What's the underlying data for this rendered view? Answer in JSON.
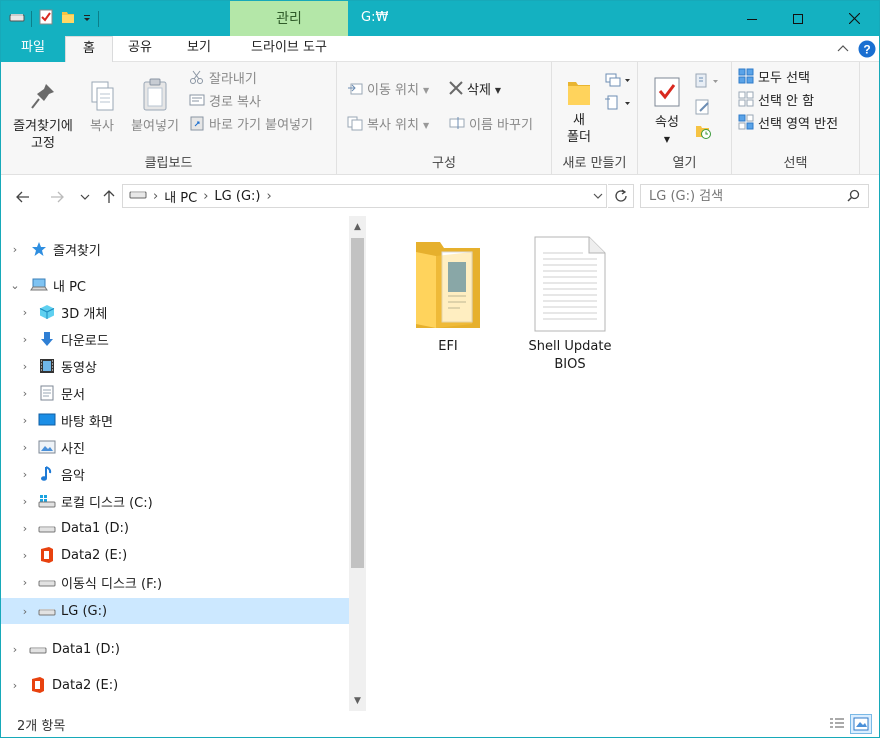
{
  "titlebar": {
    "context_tab": "관리",
    "title": "G:₩",
    "minimize_label": "minimize",
    "maximize_label": "maximize",
    "close_label": "close"
  },
  "tabs": {
    "file": "파일",
    "home": "홈",
    "share": "공유",
    "view": "보기",
    "drive_tools": "드라이브 도구"
  },
  "ribbon": {
    "clipboard": {
      "label": "클립보드",
      "pin_line1": "즐겨찾기에",
      "pin_line2": "고정",
      "copy": "복사",
      "paste": "붙여넣기",
      "cut": "잘라내기",
      "copy_path": "경로 복사",
      "paste_shortcut": "바로 가기 붙여넣기"
    },
    "organize": {
      "label": "구성",
      "move_to": "이동 위치",
      "copy_to": "복사 위치",
      "delete": "삭제",
      "rename": "이름 바꾸기"
    },
    "new": {
      "label": "새로 만들기",
      "new_folder_line1": "새",
      "new_folder_line2": "폴더"
    },
    "open": {
      "label": "열기",
      "properties": "속성"
    },
    "select": {
      "label": "선택",
      "select_all": "모두 선택",
      "select_none": "선택 안 함",
      "invert": "선택 영역 반전"
    }
  },
  "address": {
    "crumbs": [
      "내 PC",
      "LG (G:)"
    ],
    "search_placeholder": "LG (G:) 검색"
  },
  "tree": [
    {
      "label": "즐겨찾기",
      "icon": "star-icon"
    },
    {
      "label": "내 PC",
      "icon": "pc-icon"
    },
    {
      "label": "3D 개체",
      "icon": "cube-icon"
    },
    {
      "label": "다운로드",
      "icon": "download-icon"
    },
    {
      "label": "동영상",
      "icon": "video-icon"
    },
    {
      "label": "문서",
      "icon": "document-icon"
    },
    {
      "label": "바탕 화면",
      "icon": "desktop-icon"
    },
    {
      "label": "사진",
      "icon": "picture-icon"
    },
    {
      "label": "음악",
      "icon": "music-icon"
    },
    {
      "label": "로컬 디스크 (C:)",
      "icon": "windows-drive-icon"
    },
    {
      "label": "Data1 (D:)",
      "icon": "drive-icon"
    },
    {
      "label": "Data2 (E:)",
      "icon": "office-icon"
    },
    {
      "label": "이동식 디스크 (F:)",
      "icon": "drive-icon"
    },
    {
      "label": "LG (G:)",
      "icon": "drive-icon"
    },
    {
      "label": "Data1 (D:)",
      "icon": "drive-icon"
    },
    {
      "label": "Data2 (E:)",
      "icon": "office-icon"
    }
  ],
  "files": [
    {
      "name": "EFI",
      "type": "folder"
    },
    {
      "name_line1": "Shell Update",
      "name_line2": "BIOS",
      "type": "file"
    }
  ],
  "status": {
    "count": "2개 항목"
  },
  "colors": {
    "accent": "#14b1c1",
    "context_tab": "#b4e7a8",
    "selection": "#cce8ff"
  }
}
